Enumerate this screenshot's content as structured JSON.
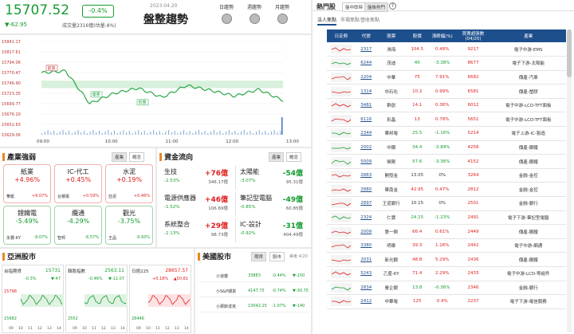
{
  "index": {
    "value": "15707.52",
    "pct": "-0.4%",
    "change": "▼-62.95",
    "volume": "成交量2316億(估量-8%)",
    "date": "2023.04.20",
    "title": "盤整趨勢",
    "periods": [
      "日趨勢",
      "週趨勢",
      "月趨勢"
    ]
  },
  "chart": {
    "y_ticks": [
      "15841.17",
      "15817.61",
      "15794.06",
      "15770.47",
      "15746.90",
      "15723.35",
      "15699.77",
      "15676.20",
      "15652.63",
      "15629.06"
    ],
    "x_ticks": [
      "09:00",
      "10:00",
      "11:00",
      "12:00",
      "13:00"
    ],
    "labels": [
      "前高",
      "緩量",
      "低量"
    ]
  },
  "chart_data": {
    "type": "line",
    "title": "",
    "x": [
      "09:00",
      "10:00",
      "11:00",
      "12:00",
      "13:00"
    ],
    "ylim": [
      15629.06,
      15841.17
    ],
    "series": [
      {
        "name": "",
        "values": [
          15770,
          15774,
          15700,
          15723,
          15735,
          15714,
          15741,
          15730,
          15717,
          15732,
          15707
        ]
      }
    ]
  },
  "industry": {
    "title": "產業強弱",
    "tabs": [
      "產業",
      "概念"
    ],
    "cards": [
      {
        "name": "紙業",
        "pct": "+4.96%",
        "stock": "華紙",
        "spct": "+9.07%",
        "cls": "up"
      },
      {
        "name": "IC-代工",
        "pct": "+0.45%",
        "stock": "台積電",
        "spct": "+0.59%",
        "cls": "up"
      },
      {
        "name": "水泥",
        "pct": "+0.19%",
        "stock": "亞泥",
        "spct": "+0.46%",
        "cls": "up"
      },
      {
        "name": "鋰鐵電",
        "pct": "-5.49%",
        "stock": "永豐-KY",
        "spct": "-9.07%",
        "cls": "dn"
      },
      {
        "name": "纜通",
        "pct": "-4.29%",
        "stock": "智邦",
        "spct": "-6.57%",
        "cls": "dn"
      },
      {
        "name": "觀光",
        "pct": "-3.75%",
        "stock": "王品",
        "spct": "-9.93%",
        "cls": "dn"
      }
    ]
  },
  "flow": {
    "title": "資金流向",
    "tabs": [
      "產業",
      "概念"
    ],
    "left": [
      {
        "name": "生技",
        "pct": "-2.53%",
        "amt": "+76億",
        "vol": "346.17億",
        "cls": "up"
      },
      {
        "name": "電源供應器",
        "pct": "-1.52%",
        "amt": "+46億",
        "vol": "106.69億",
        "cls": "up"
      },
      {
        "name": "系統整合",
        "pct": "-2.13%",
        "amt": "+29億",
        "vol": "98.73億",
        "cls": "up"
      }
    ],
    "right": [
      {
        "name": "太陽能",
        "pct": "-3.07%",
        "amt": "-54億",
        "vol": "95.31億",
        "cls": "dn"
      },
      {
        "name": "筆記型電腦",
        "pct": "-0.85%",
        "amt": "-49億",
        "vol": "60.85億",
        "cls": "dn"
      },
      {
        "name": "IC-設計",
        "pct": "-0.92%",
        "amt": "-31億",
        "vol": "404.49億",
        "cls": "dn"
      }
    ]
  },
  "asia": {
    "title": "亞洲股市",
    "items": [
      {
        "name": "台指期貨",
        "val": "15731",
        "pct": "-0.3%",
        "chg": "▼-47",
        "hi": "15798",
        "lo": "15682"
      },
      {
        "name": "韓股指數",
        "val": "2563.11",
        "pct": "-0.46%",
        "chg": "▼-11.07",
        "hi": "",
        "lo": "2552"
      },
      {
        "name": "日經225",
        "val": "28657.57",
        "pct": "+0.18%",
        "chg": "▲50.81",
        "hi": "",
        "lo": "28446"
      }
    ],
    "x_ticks": [
      "09",
      "10",
      "11",
      "12",
      "13",
      "14"
    ]
  },
  "us": {
    "title": "美國股市",
    "tabs": [
      "期貨",
      "股市"
    ],
    "date": "美東 4/20",
    "rows": [
      {
        "name": "小道瓊",
        "val": "33883",
        "pct": "-0.44%",
        "chg": "▼-150"
      },
      {
        "name": "小S&P期貨",
        "val": "4147.75",
        "pct": "-0.74%",
        "chg": "▼-30.75"
      },
      {
        "name": "小那斯達克",
        "val": "13042.25",
        "pct": "-1.07%",
        "chg": "▼-140"
      }
    ]
  },
  "hot": {
    "title": "熱門股",
    "tabs_top": [
      "盤中即時",
      "盤後熱門"
    ],
    "tabs_sub": [
      "法人焦點",
      "市場焦點",
      "營收焦點"
    ],
    "headers": [
      "日走勢",
      "代號",
      "股票",
      "股價",
      "漲跌幅(%)",
      "買賣超張數(04/20)",
      "產業"
    ],
    "rows": [
      {
        "code": "2317",
        "name": "鴻海",
        "price": "104.5",
        "pct": "0.48%",
        "vol": "9217",
        "ind": "電子中游-EMS",
        "cls": "up"
      },
      {
        "code": "6244",
        "name": "茂迪",
        "price": "40",
        "pct": "-3.38%",
        "vol": "8677",
        "ind": "電子下游-太陽能",
        "cls": "dn"
      },
      {
        "code": "2204",
        "name": "中華",
        "price": "75",
        "pct": "7.91%",
        "vol": "6682",
        "ind": "傳產-汽車",
        "cls": "up"
      },
      {
        "code": "1314",
        "name": "中石化",
        "price": "10.2",
        "pct": "0.99%",
        "vol": "6581",
        "ind": "傳產-塑膠",
        "cls": "up"
      },
      {
        "code": "3481",
        "name": "群創",
        "price": "14.1",
        "pct": "0.36%",
        "vol": "6012",
        "ind": "電子中游-LCD-TFT面板",
        "cls": "up"
      },
      {
        "code": "6116",
        "name": "彩晶",
        "price": "13",
        "pct": "0.78%",
        "vol": "5651",
        "ind": "電子中游-LCD-TFT面板",
        "cls": "up"
      },
      {
        "code": "2344",
        "name": "華邦電",
        "price": "25.5",
        "pct": "-1.16%",
        "vol": "5214",
        "ind": "電子上游-IC-製造",
        "cls": "dn"
      },
      {
        "code": "2002",
        "name": "中鋼",
        "price": "34.4",
        "pct": "-3.89%",
        "vol": "4258",
        "ind": "傳產-鋼鐵",
        "cls": "dn"
      },
      {
        "code": "5009",
        "name": "榮剛",
        "price": "57.6",
        "pct": "-3.36%",
        "vol": "4152",
        "ind": "傳產-鋼鐵",
        "cls": "dn"
      },
      {
        "code": "2883",
        "name": "開發金",
        "price": "13.05",
        "pct": "0%",
        "vol": "3264",
        "ind": "金融-金控",
        "cls": ""
      },
      {
        "code": "2880",
        "name": "華南金",
        "price": "42.95",
        "pct": "0.47%",
        "vol": "2812",
        "ind": "金融-金控",
        "cls": "up"
      },
      {
        "code": "2897",
        "name": "王道銀行",
        "price": "10.15",
        "pct": "0%",
        "vol": "2501",
        "ind": "金融-銀行",
        "cls": ""
      },
      {
        "code": "2324",
        "name": "仁寶",
        "price": "24.15",
        "pct": "-1.23%",
        "vol": "2491",
        "ind": "電子下游-筆記型電腦",
        "cls": "dn"
      },
      {
        "code": "2009",
        "name": "第一銅",
        "price": "66.4",
        "pct": "0.61%",
        "vol": "2449",
        "ind": "傳產-鋼鐵",
        "cls": "up"
      },
      {
        "code": "3380",
        "name": "明泰",
        "price": "39.3",
        "pct": "1.16%",
        "vol": "2442",
        "ind": "電子中游-網通",
        "cls": "up"
      },
      {
        "code": "2031",
        "name": "新光鋼",
        "price": "48.8",
        "pct": "5.29%",
        "vol": "2436",
        "ind": "傳產-鋼鐵",
        "cls": "up"
      },
      {
        "code": "5243",
        "name": "乙盛-KY",
        "price": "71.4",
        "pct": "2.29%",
        "vol": "2433",
        "ind": "電子中游-LCD-零組件",
        "cls": "up"
      },
      {
        "code": "2834",
        "name": "臺企銀",
        "price": "13.8",
        "pct": "-0.36%",
        "vol": "2346",
        "ind": "金融-銀行",
        "cls": "dn"
      },
      {
        "code": "2412",
        "name": "中華電",
        "price": "125",
        "pct": "0.4%",
        "vol": "2237",
        "ind": "電子下游-電信服務",
        "cls": "up"
      }
    ]
  }
}
